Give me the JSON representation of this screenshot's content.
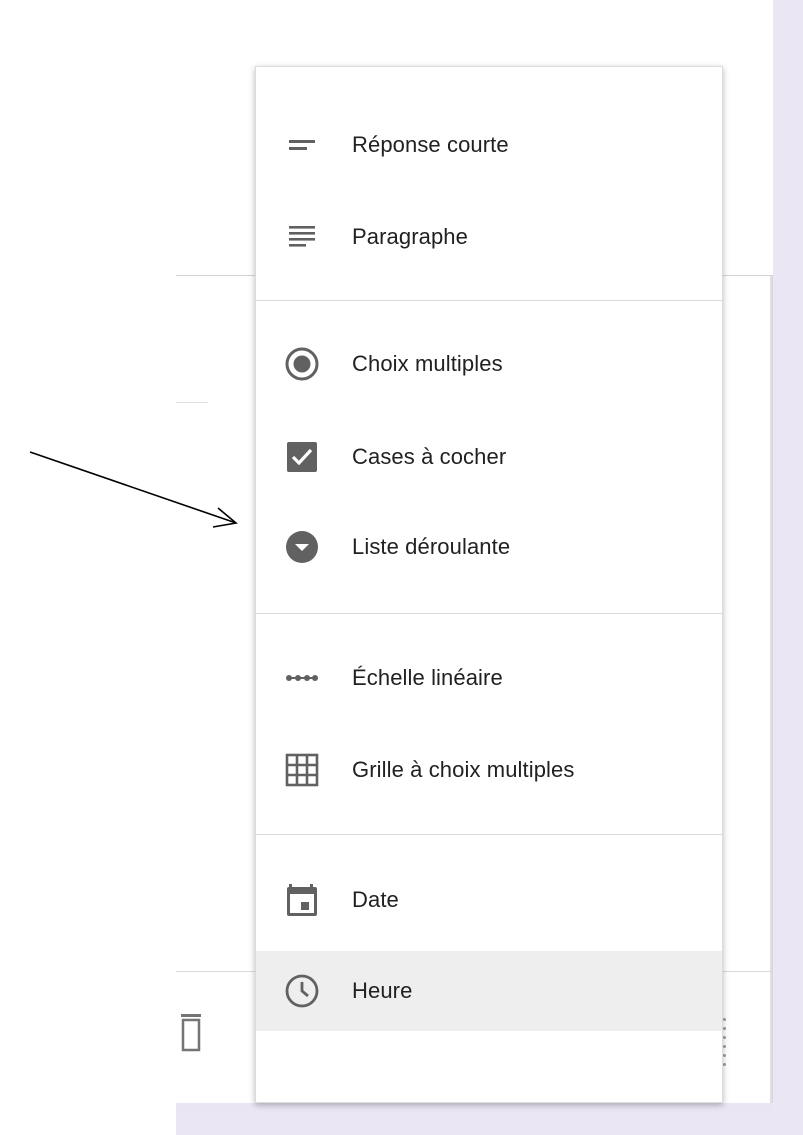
{
  "menu": {
    "items": [
      {
        "label": "Réponse courte",
        "icon": "short-text-icon"
      },
      {
        "label": "Paragraphe",
        "icon": "paragraph-icon"
      },
      {
        "label": "Choix multiples",
        "icon": "radio-button-icon"
      },
      {
        "label": "Cases à cocher",
        "icon": "checkbox-icon"
      },
      {
        "label": "Liste déroulante",
        "icon": "dropdown-icon"
      },
      {
        "label": "Échelle linéaire",
        "icon": "linear-scale-icon"
      },
      {
        "label": "Grille à choix multiples",
        "icon": "grid-icon"
      },
      {
        "label": "Date",
        "icon": "calendar-icon"
      },
      {
        "label": "Heure",
        "icon": "clock-icon"
      }
    ],
    "highlighted_item": "Heure"
  },
  "colors": {
    "icon": "#616161",
    "text": "#212121",
    "highlight": "#eeeeee",
    "divider": "#dadada",
    "page_background": "#ebe6f4"
  }
}
